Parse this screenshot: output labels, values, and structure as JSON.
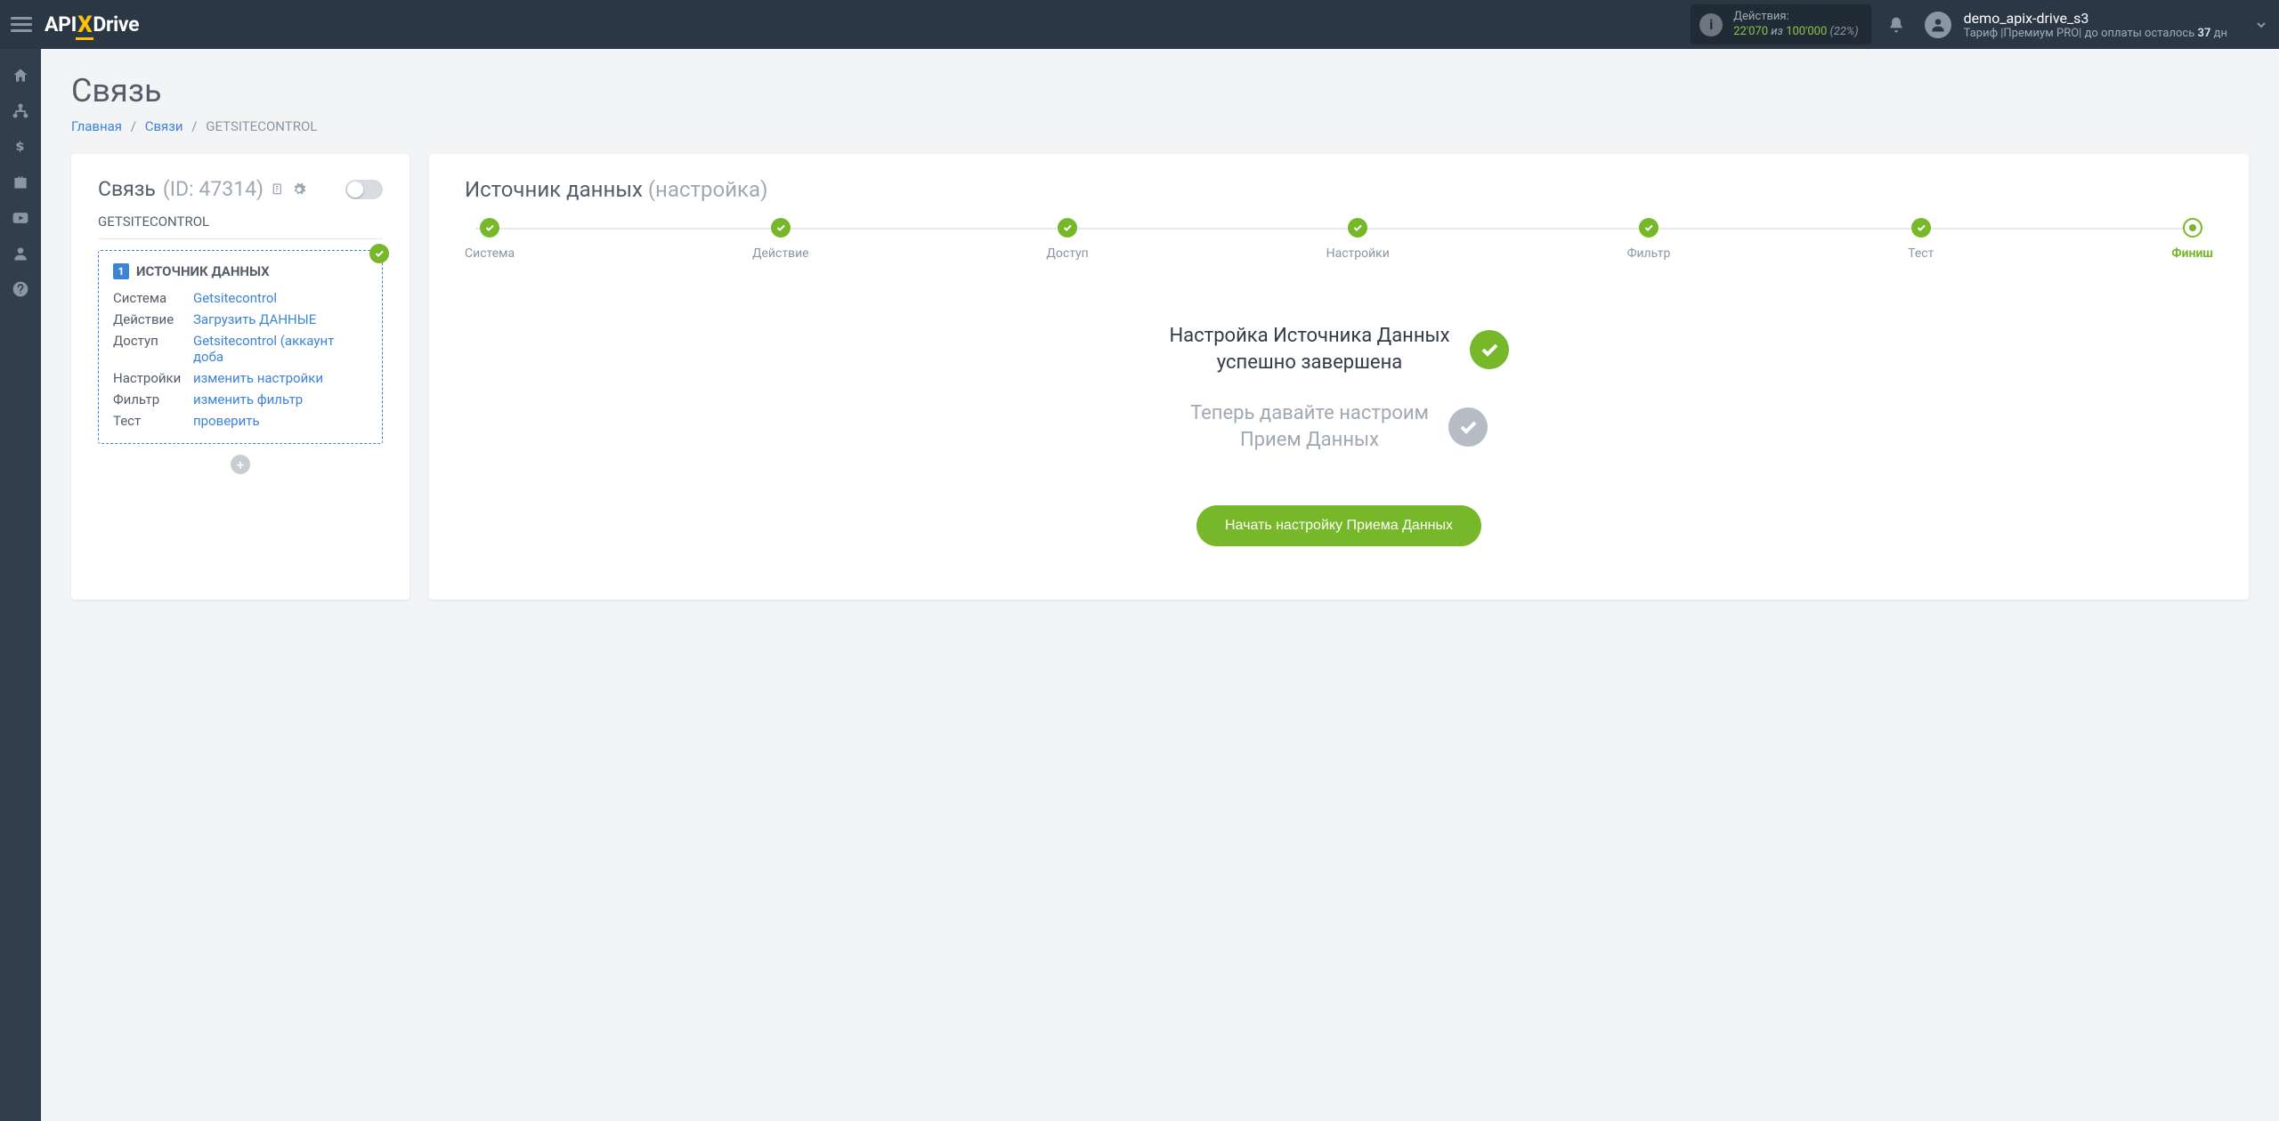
{
  "topbar": {
    "actions_label": "Действия:",
    "actions_used": "22'070",
    "actions_iz": "из",
    "actions_total": "100'000",
    "actions_pct": "(22%)",
    "username": "demo_apix-drive_s3",
    "tariff_prefix": "Тариф |Премиум PRO| до оплаты осталось ",
    "tariff_days": "37",
    "tariff_suffix": " дн"
  },
  "page": {
    "title": "Связь",
    "breadcrumb_home": "Главная",
    "breadcrumb_links": "Связи",
    "breadcrumb_current": "GETSITECONTROL"
  },
  "left": {
    "title": "Связь",
    "id_label": "(ID: 47314)",
    "conn_name": "GETSITECONTROL",
    "src_heading": "ИСТОЧНИК ДАННЫХ",
    "rows": {
      "system_k": "Система",
      "system_v": "Getsitecontrol",
      "action_k": "Действие",
      "action_v": "Загрузить ДАННЫЕ",
      "access_k": "Доступ",
      "access_v": "Getsitecontrol (аккаунт доба",
      "settings_k": "Настройки",
      "settings_v": "изменить настройки",
      "filter_k": "Фильтр",
      "filter_v": "изменить фильтр",
      "test_k": "Тест",
      "test_v": "проверить"
    }
  },
  "right": {
    "title": "Источник данных",
    "title_setup": "(настройка)",
    "steps": [
      "Система",
      "Действие",
      "Доступ",
      "Настройки",
      "Фильтр",
      "Тест",
      "Финиш"
    ],
    "done_line1": "Настройка Источника Данных",
    "done_line2": "успешно завершена",
    "pending_line1": "Теперь давайте настроим",
    "pending_line2": "Прием Данных",
    "cta": "Начать настройку Приема Данных"
  }
}
